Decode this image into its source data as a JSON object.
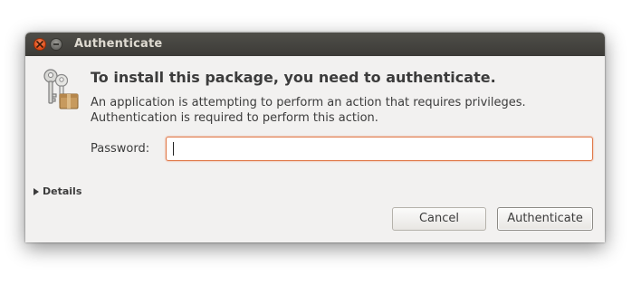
{
  "window": {
    "title": "Authenticate"
  },
  "dialog": {
    "heading": "To install this package, you need to authenticate.",
    "message_line1": "An application is attempting to perform an action that requires privileges.",
    "message_line2": "Authentication is required to perform this action.",
    "icon": "keys-icon"
  },
  "password": {
    "label": "Password:",
    "value": ""
  },
  "details": {
    "label": "Details",
    "icon": "triangle-right-icon"
  },
  "buttons": {
    "cancel": "Cancel",
    "authenticate": "Authenticate"
  },
  "colors": {
    "titlebar": "#3c3b37",
    "close_button": "#df4a16",
    "focus_border": "#e07a4a",
    "dialog_background": "#f2f1f0"
  }
}
